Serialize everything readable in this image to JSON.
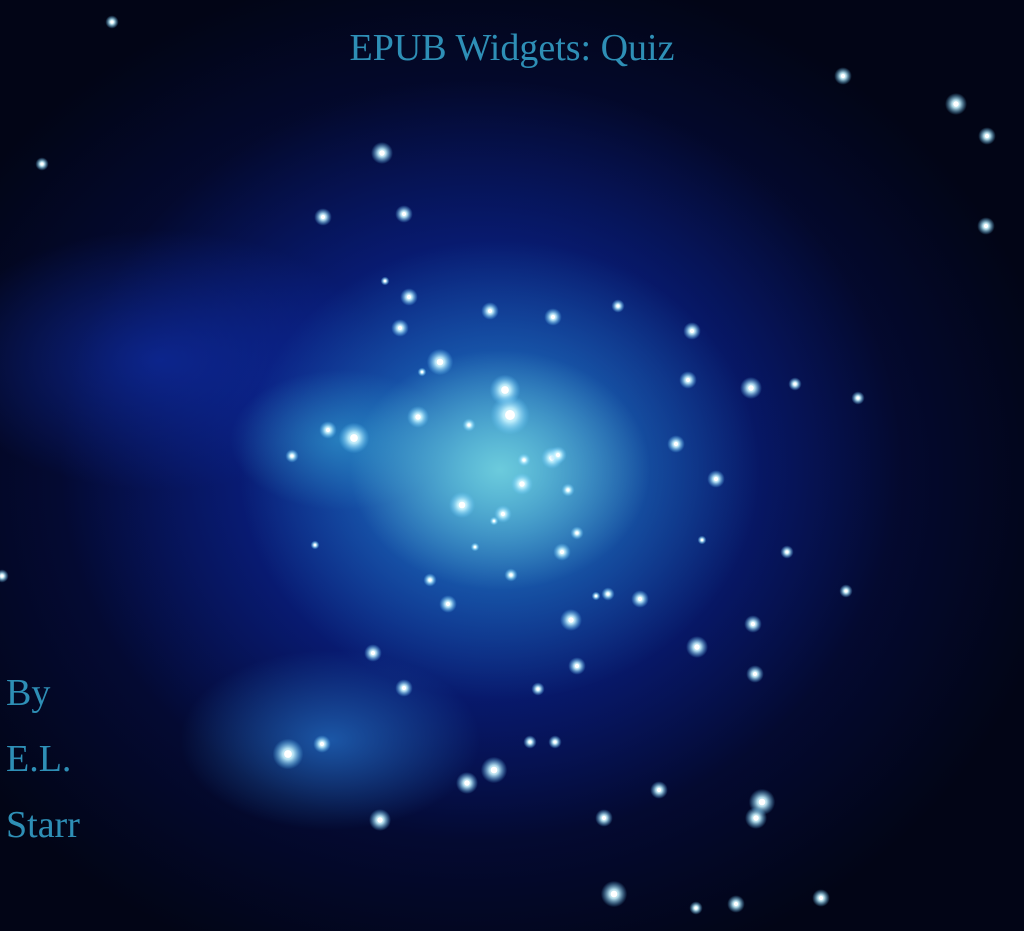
{
  "cover": {
    "title": "EPUB Widgets: Quiz",
    "author_lines": [
      "By",
      "E.L.",
      "Starr"
    ]
  },
  "colors": {
    "text": "#2e8fb6",
    "background": "#020516",
    "nebula_core": "#78d7e1",
    "nebula_outer": "#0c2daa"
  },
  "image": "star cluster in deep blue space"
}
